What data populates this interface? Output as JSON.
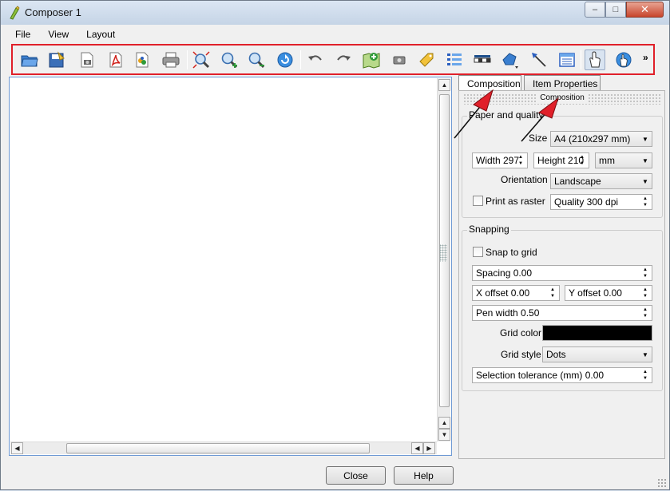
{
  "window": {
    "title": "Composer 1",
    "controls": {
      "minimize": "–",
      "maximize": "□",
      "close": "✕"
    }
  },
  "menubar": {
    "items": [
      "File",
      "View",
      "Layout"
    ]
  },
  "toolbar": {
    "highlight_color": "#e0202a",
    "more": "»",
    "icons": [
      "open-template-icon",
      "save-template-icon",
      "export-image-icon",
      "export-pdf-icon",
      "export-svg-icon",
      "print-icon",
      "zoom-full-icon",
      "zoom-in-icon",
      "zoom-out-icon",
      "refresh-icon",
      "undo-icon",
      "redo-icon",
      "add-map-icon",
      "add-image-icon",
      "add-label-icon",
      "add-legend-icon",
      "add-scalebar-icon",
      "add-shape-icon",
      "add-arrow-icon",
      "add-table-icon",
      "select-move-icon",
      "move-content-icon"
    ]
  },
  "tabs": {
    "composition": "Composition",
    "item_properties": "Item Properties"
  },
  "panel": {
    "section_title": "Composition",
    "paper": {
      "title": "Paper and quality",
      "size_label": "Size",
      "size_value": "A4 (210x297 mm)",
      "width_value": "Width 297",
      "height_value": "Height 210",
      "unit_value": "mm",
      "orientation_label": "Orientation",
      "orientation_value": "Landscape",
      "print_raster_label": "Print as raster",
      "quality_value": "Quality 300 dpi"
    },
    "snapping": {
      "title": "Snapping",
      "snap_label": "Snap to grid",
      "spacing_value": "Spacing 0.00",
      "x_offset_value": "X offset 0.00",
      "y_offset_value": "Y offset 0.00",
      "pen_width_value": "Pen width 0.50",
      "grid_color_label": "Grid color",
      "grid_color": "#000000",
      "grid_style_label": "Grid style",
      "grid_style_value": "Dots",
      "tolerance_value": "Selection tolerance (mm) 0.00"
    }
  },
  "buttons": {
    "close": "Close",
    "help": "Help"
  },
  "annotation_color": "#e0202a"
}
